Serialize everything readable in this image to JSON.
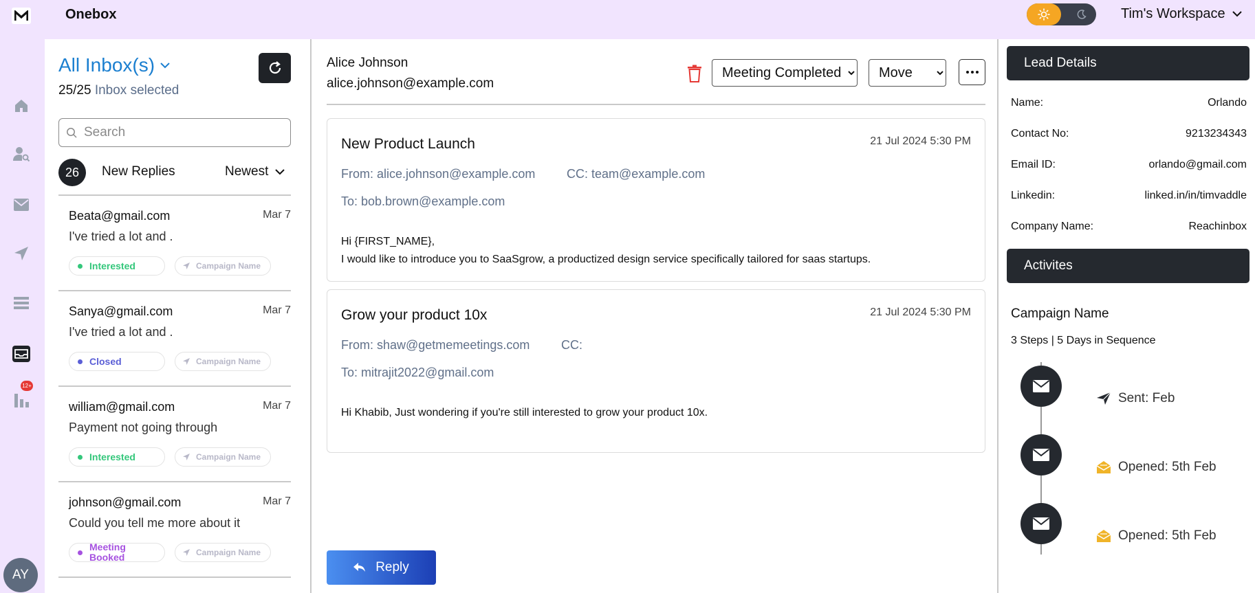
{
  "app": {
    "title": "Onebox",
    "logo_letter": "M",
    "workspace": "Tim's Workspace"
  },
  "nav": {
    "badge": "12+",
    "avatar_initials": "AY"
  },
  "inbox": {
    "title": "All Inbox(s)",
    "selected_count": "25/25",
    "selected_label": "Inbox selected",
    "search_placeholder": "Search",
    "new_count": "26",
    "new_label": "New Replies",
    "sort_label": "Newest",
    "items": [
      {
        "email": "Beata@gmail.com",
        "date": "Mar 7",
        "preview": "I've tried a lot and .",
        "status": "Interested",
        "campaign": "Campaign Name"
      },
      {
        "email": "Sanya@gmail.com",
        "date": "Mar 7",
        "preview": "I've tried a lot and .",
        "status": "Closed",
        "campaign": "Campaign Name"
      },
      {
        "email": "william@gmail.com",
        "date": "Mar 7",
        "preview": "Payment not going through",
        "status": "Interested",
        "campaign": "Campaign Name"
      },
      {
        "email": "johnson@gmail.com",
        "date": "Mar 7",
        "preview": "Could you tell me more about it",
        "status": "Meeting Booked",
        "campaign": "Campaign Name"
      }
    ]
  },
  "thread": {
    "sender_name": "Alice Johnson",
    "sender_email": "alice.johnson@example.com",
    "status_value": "Meeting Completed",
    "move_value": "Move",
    "reply_label": "Reply",
    "emails": [
      {
        "subject": "New Product Launch",
        "date": "21 Jul 2024 5:30 PM",
        "from": "From: alice.johnson@example.com",
        "cc": "CC: team@example.com",
        "to": "To: bob.brown@example.com",
        "body_line1": "Hi {FIRST_NAME},",
        "body_line2": "I would like to introduce you to SaaSgrow, a productized design service specifically tailored for saas startups."
      },
      {
        "subject": "Grow your product 10x",
        "date": "21 Jul 2024 5:30 PM",
        "from": "From: shaw@getmemeetings.com",
        "cc": "CC:",
        "to": "To: mitrajit2022@gmail.com",
        "body_line1": "Hi Khabib, Just wondering if you're still interested to grow your product 10x.",
        "body_line2": ""
      }
    ]
  },
  "lead": {
    "header": "Lead Details",
    "fields": [
      {
        "label": "Name:",
        "value": "Orlando"
      },
      {
        "label": "Contact No:",
        "value": "9213234343"
      },
      {
        "label": "Email ID:",
        "value": "orlando@gmail.com"
      },
      {
        "label": "Linkedin:",
        "value": "linked.in/in/timvaddle"
      },
      {
        "label": "Company Name:",
        "value": "Reachinbox"
      }
    ]
  },
  "activities": {
    "header": "Activites",
    "campaign_name": "Campaign Name",
    "steps_summary": "3 Steps | 5 Days in Sequence",
    "steps": [
      {
        "label": "Sent: Feb",
        "icon": "sent-icon"
      },
      {
        "label": "Opened: 5th Feb",
        "icon": "opened-icon"
      },
      {
        "label": "Opened: 5th Feb",
        "icon": "opened-icon"
      }
    ]
  },
  "colors": {
    "accent_blue": "#1b7fd0",
    "interested": "#34c77b",
    "closed": "#5b5fd6",
    "meeting_booked": "#a652e0",
    "danger": "#e53935",
    "opened": "#f0b429"
  }
}
